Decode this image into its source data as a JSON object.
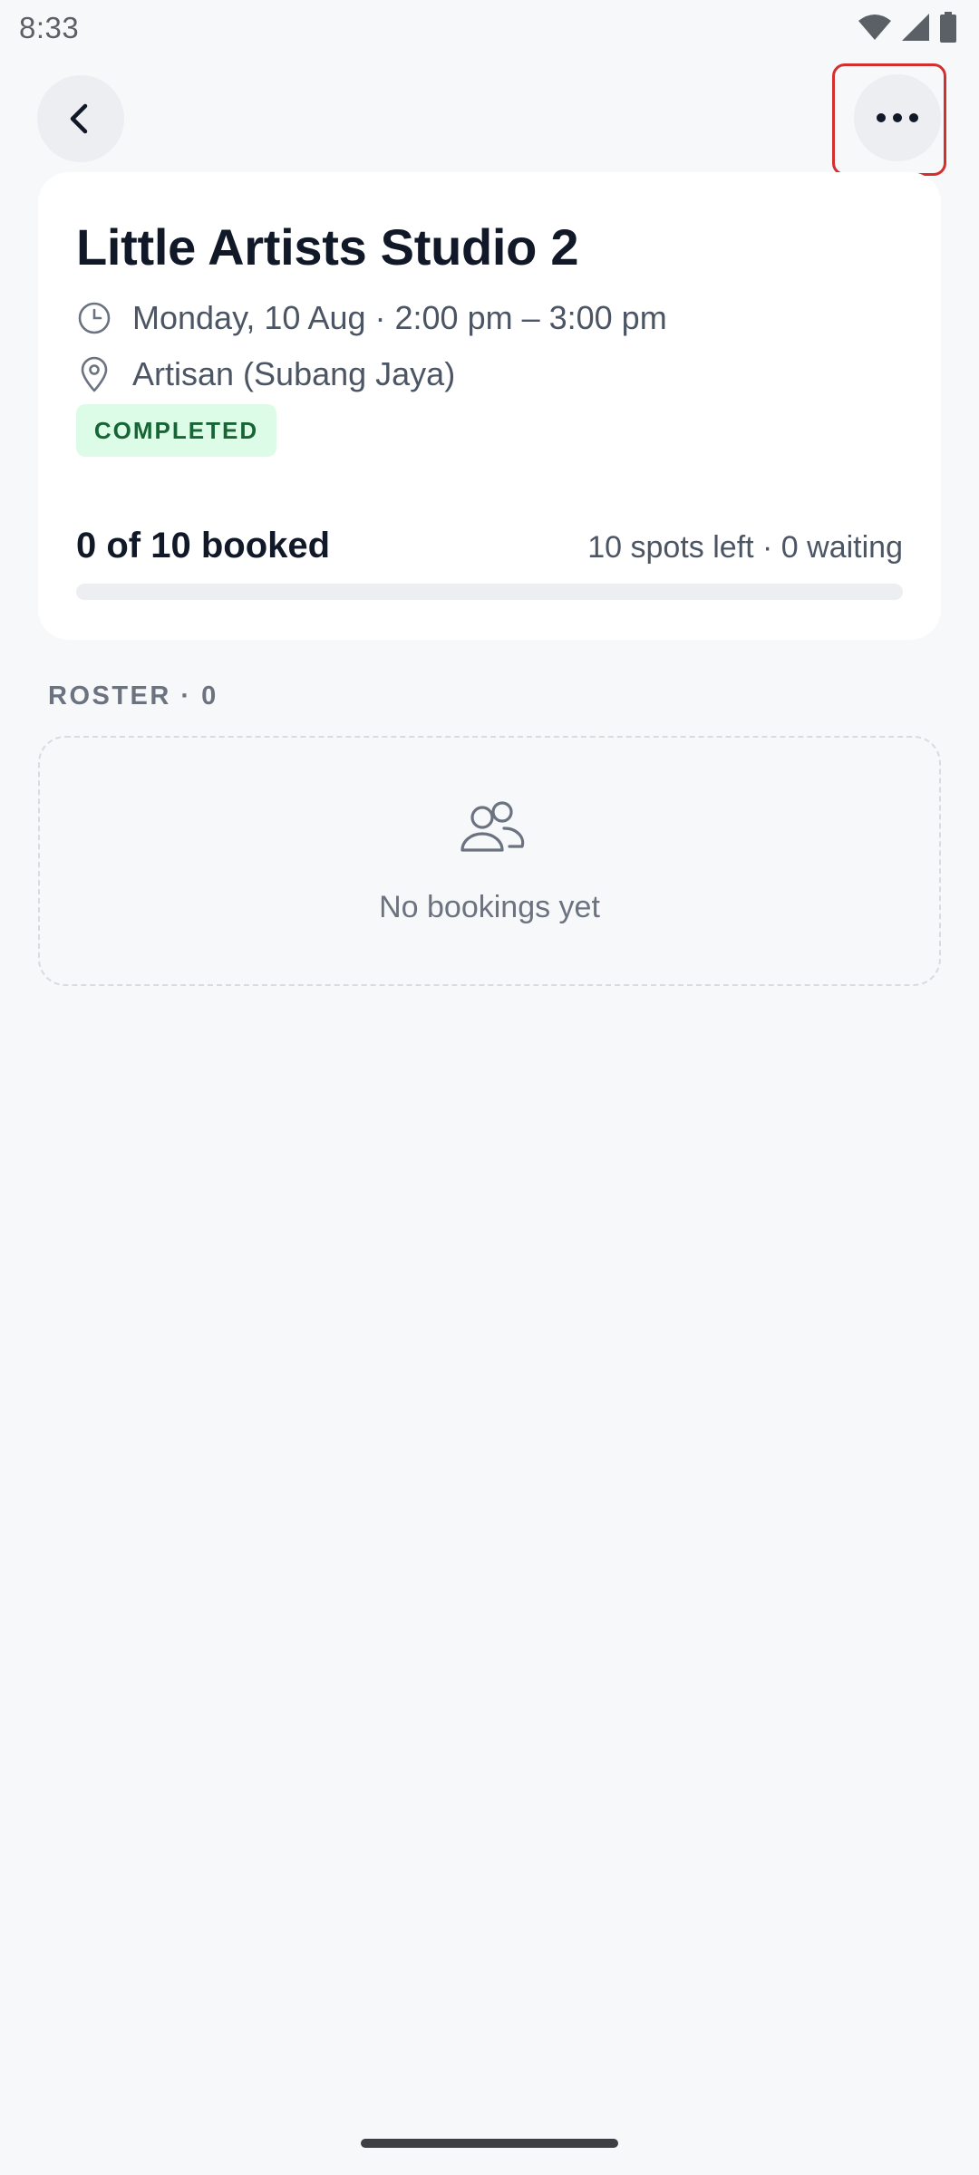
{
  "status_bar": {
    "time": "8:33"
  },
  "header": {
    "back_icon": "chevron-left-icon",
    "more_icon": "more-horizontal-icon"
  },
  "class_card": {
    "title": "Little Artists Studio 2",
    "datetime": "Monday, 10 Aug · 2:00 pm – 3:00 pm",
    "location": "Artisan (Subang Jaya)",
    "status": "COMPLETED",
    "booked_summary": "0 of 10 booked",
    "spots_summary": "10 spots left · 0 waiting",
    "progress_fraction": 0
  },
  "roster": {
    "label": "ROSTER · 0",
    "empty_icon": "users-icon",
    "empty_text": "No bookings yet"
  },
  "colors": {
    "accent_highlight": "#d32f2f",
    "badge_bg": "#dcfce7",
    "badge_text": "#166534"
  }
}
